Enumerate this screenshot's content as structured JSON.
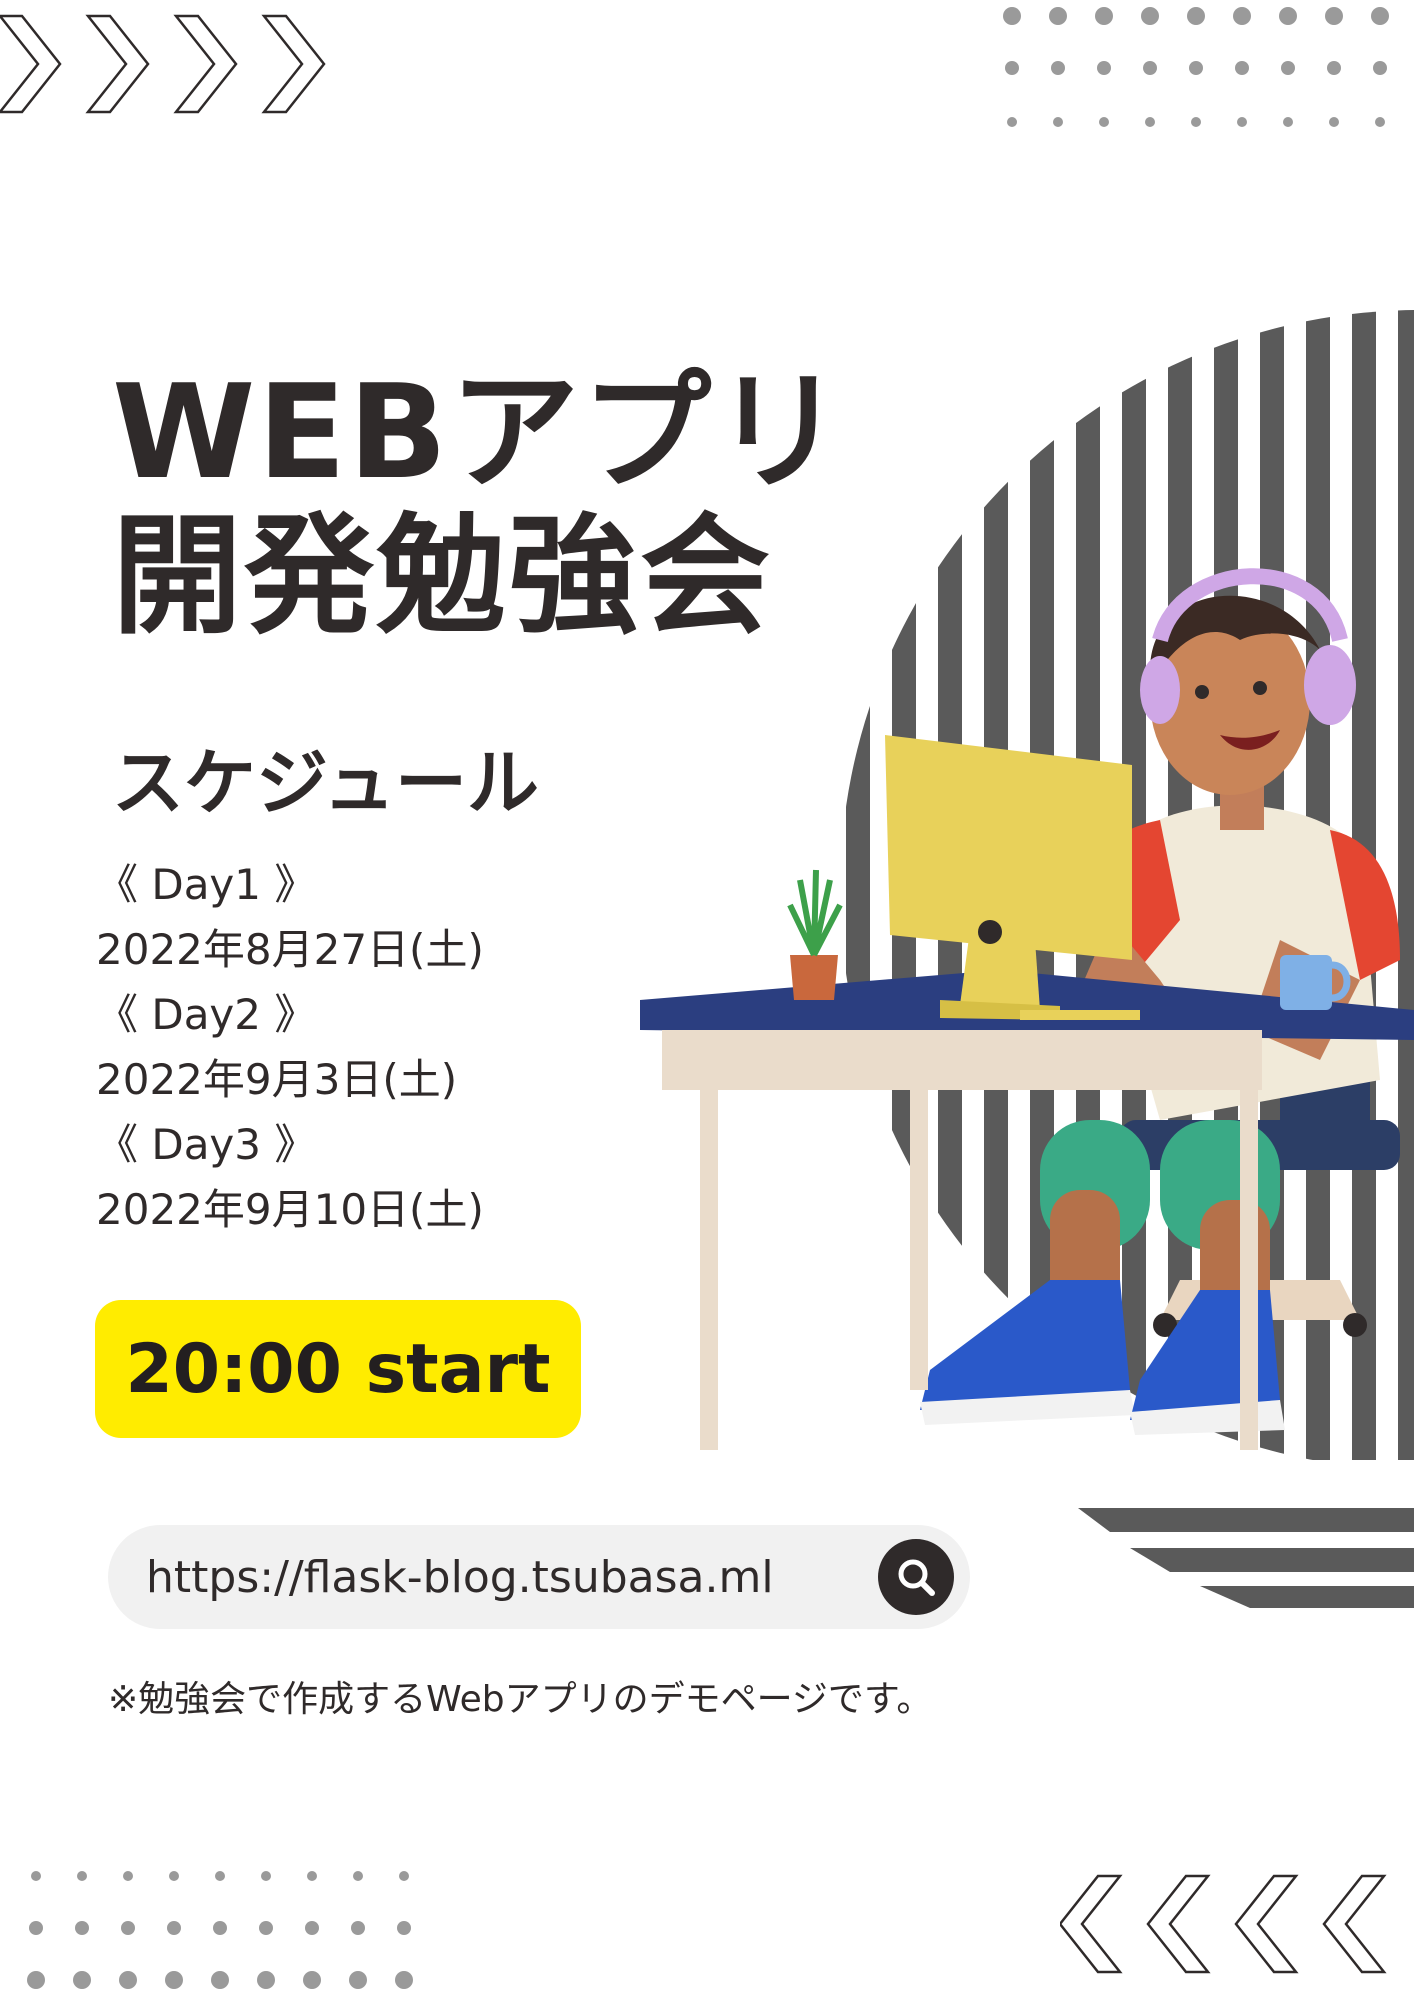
{
  "title": {
    "line1": "WEBアプリ",
    "line2": "開発勉強会"
  },
  "schedule": {
    "heading": "スケジュール",
    "days": [
      {
        "label": "《 Day1 》",
        "date": "2022年8月27日(土)"
      },
      {
        "label": "《 Day2 》",
        "date": "2022年9月3日(土)"
      },
      {
        "label": "《 Day3 》",
        "date": "2022年9月10日(土)"
      }
    ]
  },
  "start": {
    "label": "20:00 start"
  },
  "url": {
    "text": "https://flask-blog.tsubasa.ml",
    "icon": "search-icon"
  },
  "note": "※勉強会で作成するWebアプリのデモページです。",
  "colors": {
    "accent": "#ffec00",
    "text": "#2f2a2a",
    "stripes": "#5a5a5a",
    "url_bg": "#f1f1f1"
  }
}
